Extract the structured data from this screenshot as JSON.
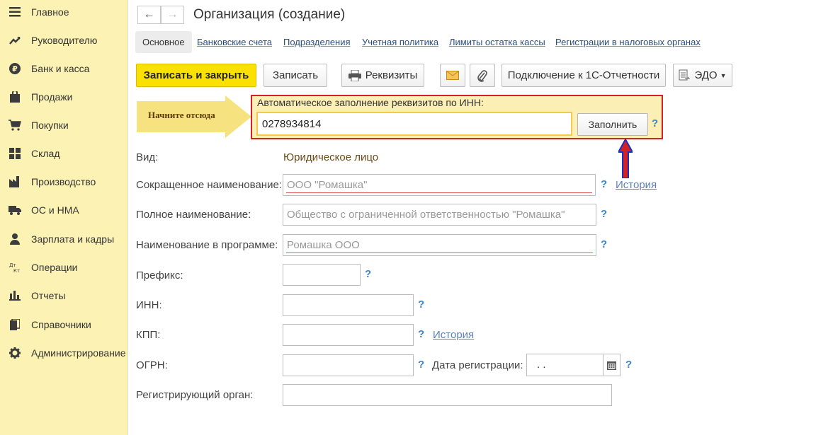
{
  "sidebar": {
    "items": [
      {
        "label": "Главное",
        "icon": "menu-icon"
      },
      {
        "label": "Руководителю",
        "icon": "trend-icon"
      },
      {
        "label": "Банк и касса",
        "icon": "ruble-icon"
      },
      {
        "label": "Продажи",
        "icon": "bag-icon"
      },
      {
        "label": "Покупки",
        "icon": "cart-icon"
      },
      {
        "label": "Склад",
        "icon": "grid-icon"
      },
      {
        "label": "Производство",
        "icon": "factory-icon"
      },
      {
        "label": "ОС и НМА",
        "icon": "truck-icon"
      },
      {
        "label": "Зарплата и кадры",
        "icon": "person-icon"
      },
      {
        "label": "Операции",
        "icon": "dt-kt-icon"
      },
      {
        "label": "Отчеты",
        "icon": "bar-chart-icon"
      },
      {
        "label": "Справочники",
        "icon": "book-icon"
      },
      {
        "label": "Администрирование",
        "icon": "gear-icon"
      }
    ]
  },
  "header": {
    "back": "←",
    "forward": "→",
    "title": "Организация (создание)"
  },
  "tabs": [
    {
      "label": "Основное"
    },
    {
      "label": "Банковские счета"
    },
    {
      "label": "Подразделения"
    },
    {
      "label": "Учетная политика"
    },
    {
      "label": "Лимиты остатка кассы"
    },
    {
      "label": "Регистрации в налоговых органах"
    }
  ],
  "toolbar": {
    "save_close": "Записать и закрыть",
    "save": "Записать",
    "requisites": "Реквизиты",
    "connect": "Подключение к 1С-Отчетности",
    "edo": "ЭДО"
  },
  "hint": {
    "start_here": "Начните отсюда"
  },
  "inn_fill": {
    "caption": "Автоматическое заполнение реквизитов по ИНН:",
    "value": "0278934814",
    "button": "Заполнить",
    "help": "?"
  },
  "form": {
    "vid_label": "Вид:",
    "vid_value": "Юридическое лицо",
    "short_name_label": "Сокращенное наименование:",
    "short_name_placeholder": "ООО \"Ромашка\"",
    "full_name_label": "Полное наименование:",
    "full_name_placeholder": "Общество с ограниченной ответственностью \"Ромашка\"",
    "program_name_label": "Наименование в программе:",
    "program_name_placeholder": "Ромашка ООО",
    "prefix_label": "Префикс:",
    "inn_label": "ИНН:",
    "kpp_label": "КПП:",
    "ogrn_label": "ОГРН:",
    "reg_date_label": "Дата регистрации:",
    "reg_date_value": " .  .",
    "reg_organ_label": "Регистрирующий орган:",
    "history": "История",
    "help": "?"
  },
  "colors": {
    "sidebar_bg": "#fbf2b3",
    "primary_button": "#fbe102",
    "highlight_border": "#d71f26",
    "link": "#284d80",
    "help": "#3a86c9",
    "annotation_arrow": "#1a2fc4"
  }
}
